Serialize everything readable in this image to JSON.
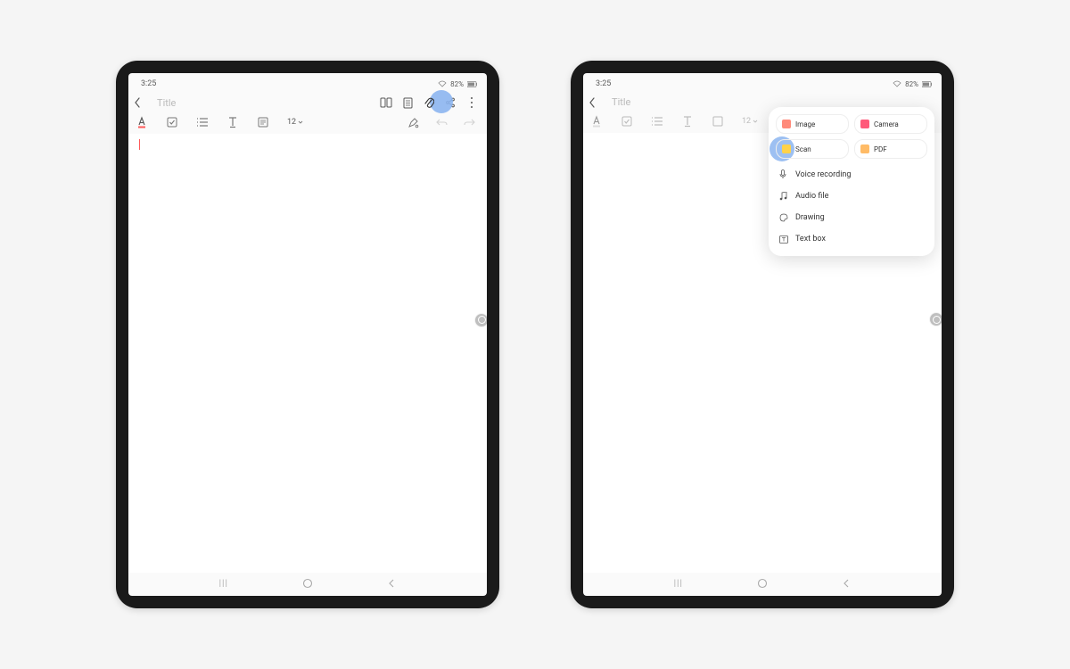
{
  "status": {
    "time": "3:25",
    "battery": "82%"
  },
  "header": {
    "title_placeholder": "Title"
  },
  "toolbar": {
    "fontsize": "12"
  },
  "nav": {
    "recents": "|||",
    "home": "○",
    "back": "‹"
  },
  "attach_menu": {
    "chips": {
      "image": "Image",
      "camera": "Camera",
      "scan": "Scan",
      "pdf": "PDF"
    },
    "items": {
      "voice": "Voice recording",
      "audio": "Audio file",
      "drawing": "Drawing",
      "textbox": "Text box"
    }
  }
}
